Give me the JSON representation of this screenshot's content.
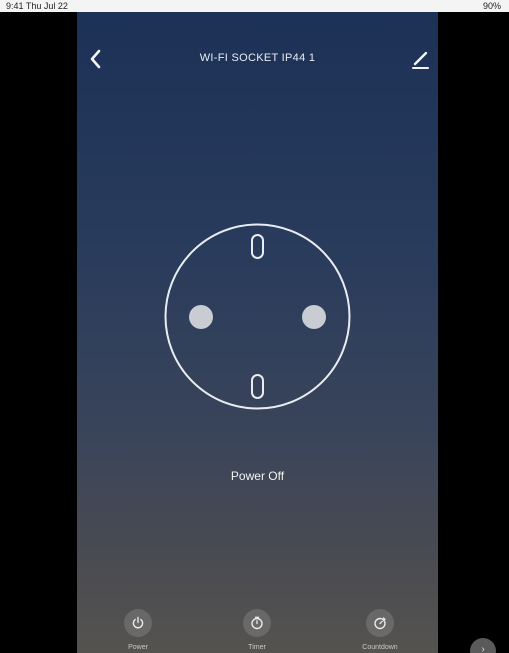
{
  "status_bar": {
    "left_text": "9:41 Thu Jul 22",
    "right_text": "90%"
  },
  "header": {
    "title": "WI-FI SOCKET IP44 1",
    "back_icon": "chevron-left-icon",
    "edit_icon": "edit-pencil-icon"
  },
  "device": {
    "state_label": "Power Off",
    "power_on": false
  },
  "controls": [
    {
      "label": "Power",
      "icon": "power-icon"
    },
    {
      "label": "Timer",
      "icon": "timer-icon"
    },
    {
      "label": "Countdown",
      "icon": "countdown-icon"
    }
  ],
  "colors": {
    "gradient_top": "#1c3156",
    "gradient_bottom": "#55534f",
    "socket_stroke": "#e9edf3",
    "pin_fill": "#c9ccd3"
  }
}
